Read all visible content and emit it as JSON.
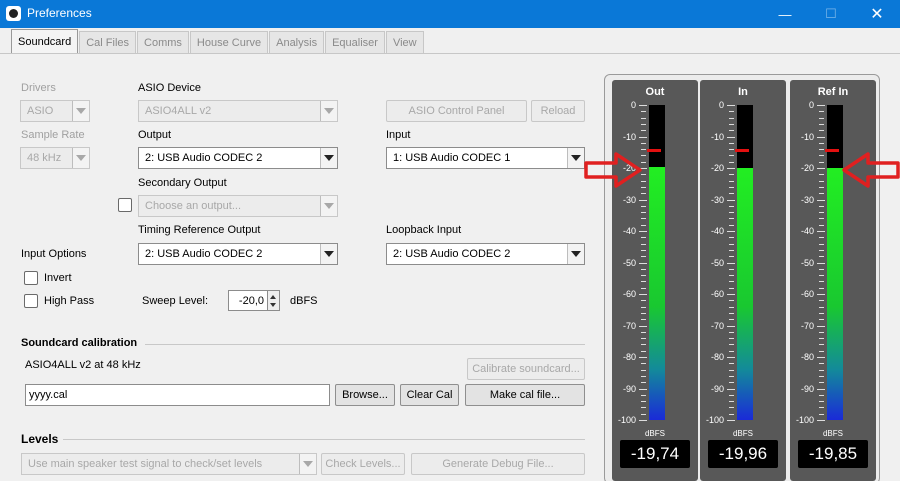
{
  "window": {
    "title": "Preferences",
    "min_glyph": "—",
    "max_glyph": "☐",
    "close_glyph": "✕"
  },
  "tabs": [
    "Soundcard",
    "Cal Files",
    "Comms",
    "House Curve",
    "Analysis",
    "Equaliser",
    "View"
  ],
  "soundcard": {
    "drivers_label": "Drivers",
    "drivers_value": "ASIO",
    "asio_device_label": "ASIO Device",
    "asio_device_value": "ASIO4ALL v2",
    "asio_control_panel": "ASIO Control Panel",
    "reload": "Reload",
    "sample_rate_label": "Sample Rate",
    "sample_rate_value": "48 kHz",
    "output_label": "Output",
    "output_value": "2: USB Audio CODEC  2",
    "input_label": "Input",
    "input_value": "1: USB Audio CODEC  1",
    "secondary_output_label": "Secondary Output",
    "secondary_output_placeholder": "Choose an output...",
    "timing_ref_label": "Timing Reference Output",
    "timing_ref_value": "2: USB Audio CODEC  2",
    "loopback_label": "Loopback Input",
    "loopback_value": "2: USB Audio CODEC  2",
    "input_options_label": "Input Options",
    "invert_label": "Invert",
    "high_pass_label": "High Pass",
    "sweep_level_label": "Sweep Level:",
    "sweep_level_value": "-20,0",
    "sweep_level_unit": "dBFS"
  },
  "calibration": {
    "title": "Soundcard calibration",
    "status": "ASIO4ALL v2 at 48 kHz",
    "calibrate_button": "Calibrate soundcard...",
    "file_value": "yyyy.cal",
    "browse_button": "Browse...",
    "clear_button": "Clear Cal",
    "make_button": "Make cal file..."
  },
  "levels": {
    "title": "Levels",
    "mode_value": "Use main speaker test signal to check/set levels",
    "check_button": "Check Levels...",
    "debug_button": "Generate Debug File..."
  },
  "meters": {
    "scale": [
      "0",
      "-10",
      "-20",
      "-30",
      "-40",
      "-50",
      "-60",
      "-70",
      "-80",
      "-90",
      "-100"
    ],
    "unit": "dBFS",
    "items": [
      {
        "title": "Out",
        "level_db": -19.74,
        "peak_db": -14.3,
        "readout": "-19,74"
      },
      {
        "title": "In",
        "level_db": -19.96,
        "peak_db": -14.3,
        "readout": "-19,96"
      },
      {
        "title": "Ref In",
        "level_db": -19.85,
        "peak_db": -14.3,
        "readout": "-19,85"
      }
    ]
  },
  "colors": {
    "titlebar": "#0a78d7",
    "meter_bg": "#585858",
    "peak": "#e31010",
    "annotation_arrow": "#e02020"
  }
}
